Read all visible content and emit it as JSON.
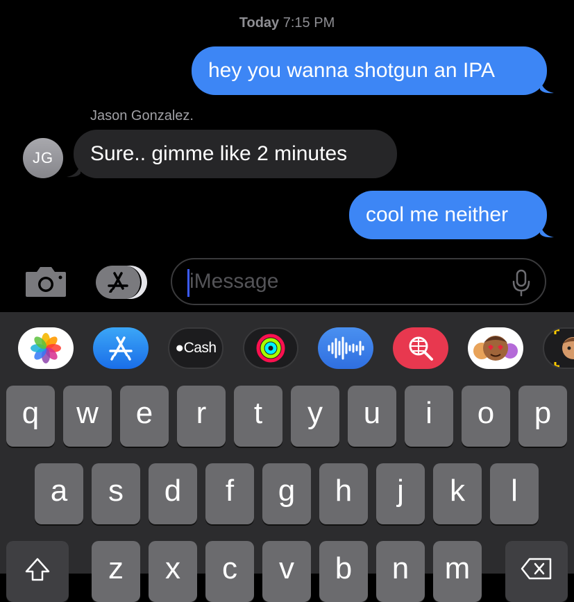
{
  "thread": {
    "timestamp_day": "Today",
    "timestamp_time": "7:15 PM",
    "messages": [
      {
        "from": "me",
        "text": "hey you wanna shotgun an IPA"
      },
      {
        "from": "Jason Gonzalez.",
        "text": "Sure.. gimme like 2 minutes"
      },
      {
        "from": "me",
        "text": "cool me neither"
      }
    ],
    "sender_name": "Jason Gonzalez.",
    "avatar_initials": "JG"
  },
  "composer": {
    "placeholder": "iMessage",
    "camera_icon": "camera-icon",
    "apps_icon": "app-store-icon",
    "mic_icon": "microphone-icon"
  },
  "app_drawer": {
    "cash_label": "Cash",
    "apps": [
      "photos",
      "app-store",
      "apple-cash",
      "activity",
      "audio-message",
      "search-images",
      "memoji-stickers",
      "memoji"
    ]
  },
  "keyboard": {
    "row1": [
      "q",
      "w",
      "e",
      "r",
      "t",
      "y",
      "u",
      "i",
      "o",
      "p"
    ],
    "row2": [
      "a",
      "s",
      "d",
      "f",
      "g",
      "h",
      "j",
      "k",
      "l"
    ],
    "row3": [
      "z",
      "x",
      "c",
      "v",
      "b",
      "n",
      "m"
    ]
  },
  "colors": {
    "outgoing_bubble": "#3d86f5",
    "incoming_bubble": "#262628",
    "background": "#000000",
    "keyboard_bg": "#2c2c2e",
    "key": "#6b6b6e"
  }
}
